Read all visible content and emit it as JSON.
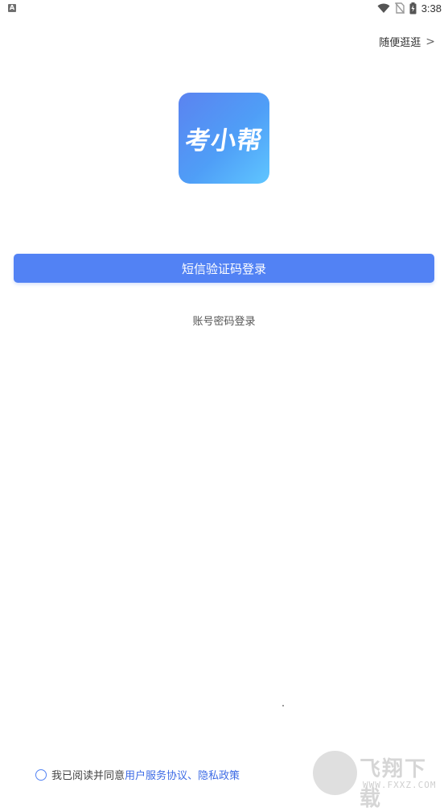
{
  "status_bar": {
    "notification_letter": "A",
    "time": "3:38",
    "icons": [
      "wifi-icon",
      "no-sim-icon",
      "battery-charging-icon"
    ]
  },
  "header": {
    "browse_label": "随便逛逛",
    "browse_chevron": ">"
  },
  "logo": {
    "text": "考小帮",
    "gradient": [
      "#5b83f0",
      "#5fc6ff"
    ]
  },
  "login": {
    "sms_button_label": "短信验证码登录",
    "password_login_label": "账号密码登录",
    "accent": "#5282f4"
  },
  "agreement": {
    "prefix": "我已阅读并同意",
    "user_agreement": "用户服务协议",
    "separator": "、",
    "privacy_policy": "隐私政策",
    "link_color": "#3d6be5"
  },
  "watermark": {
    "title": "飞翔下载",
    "domain": "WWW.FXXZ.COM"
  }
}
